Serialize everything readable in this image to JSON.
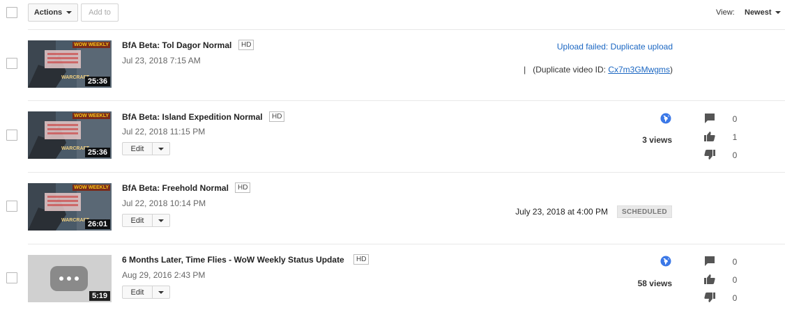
{
  "toolbar": {
    "actions_label": "Actions",
    "add_to_label": "Add to",
    "view_label": "View:",
    "sort_label": "Newest"
  },
  "videos": [
    {
      "title": "BfA Beta: Tol Dagor Normal",
      "badge": "HD",
      "date": "Jul 23, 2018 7:15 AM",
      "duration": "25:36",
      "thumb_badge": "WOW WEEKLY",
      "thumb_logo": "WARCRAFT",
      "status": "Upload failed: Duplicate upload",
      "duplicate_sep": "|",
      "duplicate_prefix": "(Duplicate video ID: ",
      "duplicate_id": "Cx7m3GMwgms",
      "duplicate_suffix": ")"
    },
    {
      "title": "BfA Beta: Island Expedition Normal",
      "badge": "HD",
      "date": "Jul 22, 2018 11:15 PM",
      "duration": "25:36",
      "thumb_badge": "WOW WEEKLY",
      "thumb_logo": "WARCRAFT",
      "edit_label": "Edit",
      "views": "3 views",
      "comments": "0",
      "likes": "1",
      "dislikes": "0"
    },
    {
      "title": "BfA Beta: Freehold Normal",
      "badge": "HD",
      "date": "Jul 22, 2018 10:14 PM",
      "duration": "26:01",
      "thumb_badge": "WOW WEEKLY",
      "thumb_logo": "WARCRAFT",
      "edit_label": "Edit",
      "scheduled_time": "July 23, 2018 at 4:00 PM",
      "scheduled_badge": "SCHEDULED"
    },
    {
      "title": "6 Months Later, Time Flies - WoW Weekly Status Update",
      "badge": "HD",
      "date": "Aug 29, 2016 2:43 PM",
      "duration": "5:19",
      "edit_label": "Edit",
      "views": "58 views",
      "comments": "0",
      "likes": "0",
      "dislikes": "0"
    }
  ],
  "colors": {
    "link": "#1a66c2",
    "globe": "#3b78e7",
    "icon": "#555555"
  }
}
